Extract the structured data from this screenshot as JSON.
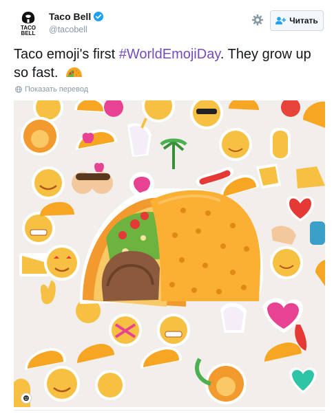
{
  "author": {
    "name": "Taco Bell",
    "handle": "@tacobell",
    "avatar_text": "TACO BELL"
  },
  "follow_button": {
    "label": "Читать"
  },
  "tweet": {
    "text_before": "Taco emoji's first ",
    "hashtag": "#WorldEmojiDay",
    "text_after": ". They grow up so fast."
  },
  "translate_link": "Показать перевод",
  "colors": {
    "hashtag": "#744bbd",
    "verified": "#1da1f2",
    "background": "#ffffff"
  },
  "icons": [
    "verified-badge-icon",
    "gear-icon",
    "follow-user-icon",
    "globe-icon",
    "taco-emoji-icon",
    "emoji-badge-icon"
  ]
}
